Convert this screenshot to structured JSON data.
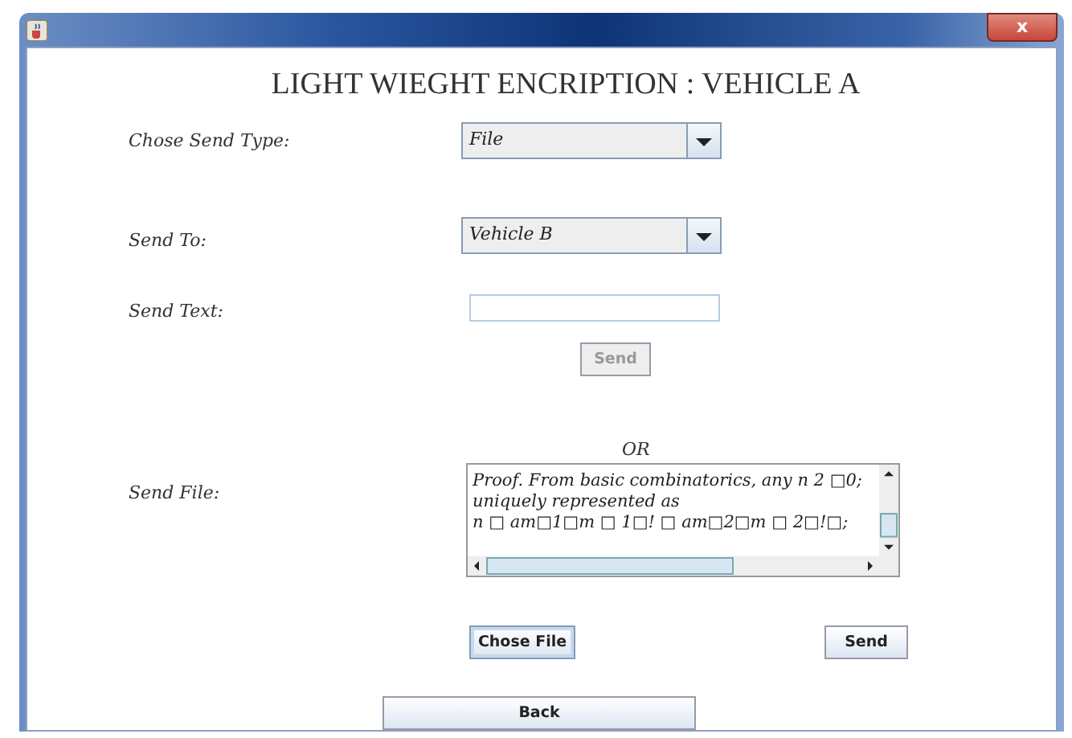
{
  "window": {
    "close": "x"
  },
  "heading": "LIGHT WIEGHT ENCRIPTION : VEHICLE A",
  "send_type": {
    "label": "Chose Send Type:",
    "value": "File"
  },
  "send_to": {
    "label": "Send To:",
    "value": "Vehicle B"
  },
  "send_text": {
    "label": "Send Text:",
    "button": {
      "label": "Send",
      "disabled": true
    }
  },
  "or": "OR",
  "send_file": {
    "label": "Send File:",
    "lines": [
      "Proof. From basic combinatorics, any n 2 □0;",
      "uniquely represented as",
      "n □ am□1□m □ 1□! □ am□2□m □ 2□!□;"
    ],
    "choose_button": {
      "label": "Chose File",
      "focused": true
    },
    "send_button": {
      "label": "Send",
      "disabled": false
    }
  },
  "back_button": "Back"
}
